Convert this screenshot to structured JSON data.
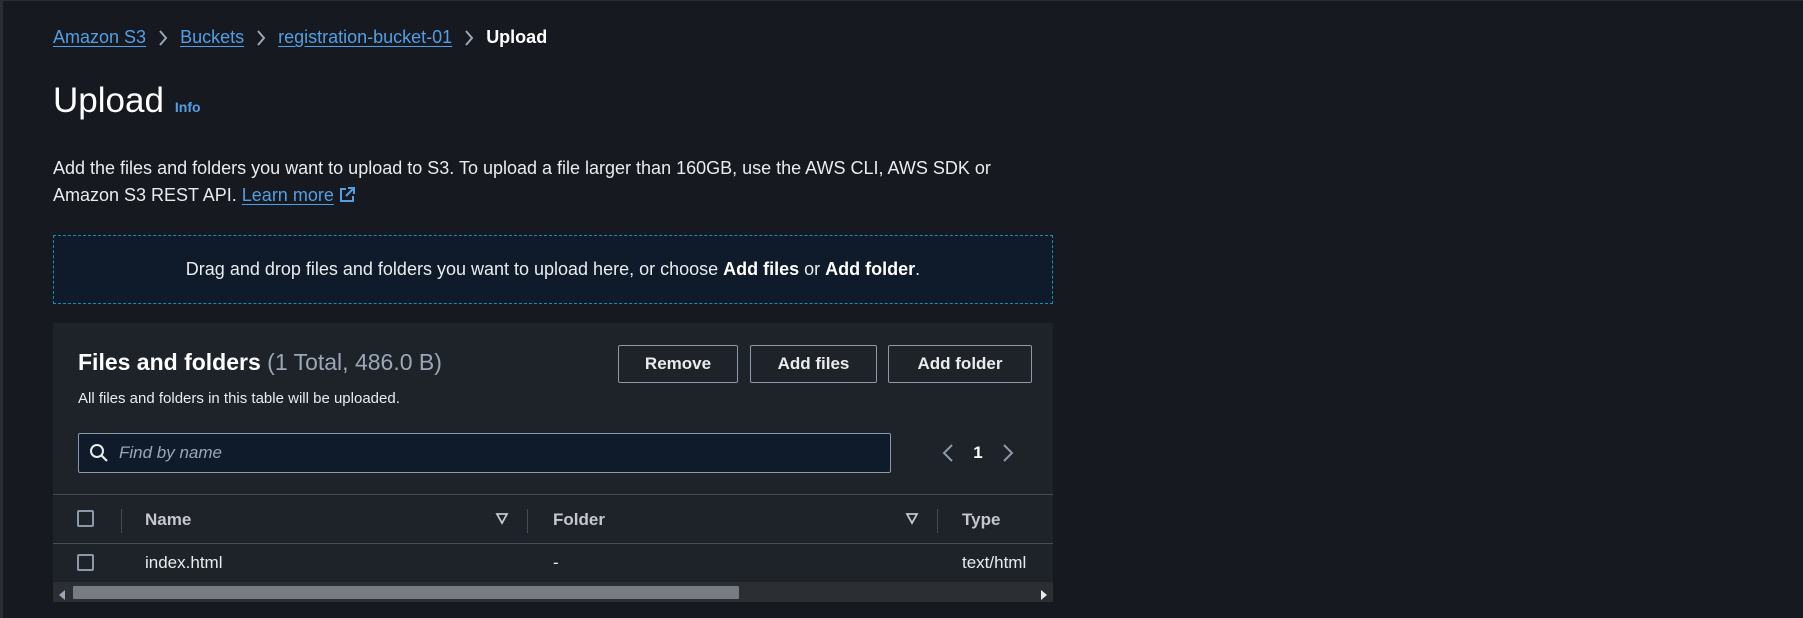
{
  "breadcrumb": {
    "items": [
      "Amazon S3",
      "Buckets",
      "registration-bucket-01"
    ],
    "current": "Upload"
  },
  "header": {
    "title": "Upload",
    "info_label": "Info"
  },
  "description": {
    "text": "Add the files and folders you want to upload to S3. To upload a file larger than 160GB, use the AWS CLI, AWS SDK or Amazon S3 REST API.",
    "learn_more": "Learn more"
  },
  "dropzone": {
    "prefix": "Drag and drop files and folders you want to upload here, or choose ",
    "add_files": "Add files",
    "or": " or ",
    "add_folder": "Add folder",
    "suffix": "."
  },
  "files_panel": {
    "title": "Files and folders",
    "count": "(1 Total, 486.0 B)",
    "subtitle": "All files and folders in this table will be uploaded.",
    "buttons": {
      "remove": "Remove",
      "add_files": "Add files",
      "add_folder": "Add folder"
    },
    "search_placeholder": "Find by name",
    "page": "1",
    "columns": [
      "Name",
      "Folder",
      "Type"
    ],
    "rows": [
      {
        "name": "index.html",
        "folder": "-",
        "type": "text/html"
      }
    ]
  },
  "colors": {
    "link": "#539fe5",
    "background": "#16191f",
    "panel": "#1e2329",
    "dropzone_border": "#1e8dad"
  },
  "icons": [
    "chevron-right-icon",
    "external-link-icon",
    "search-icon",
    "chevron-left-icon",
    "sort-down-icon",
    "scroll-left-icon",
    "scroll-right-icon"
  ]
}
